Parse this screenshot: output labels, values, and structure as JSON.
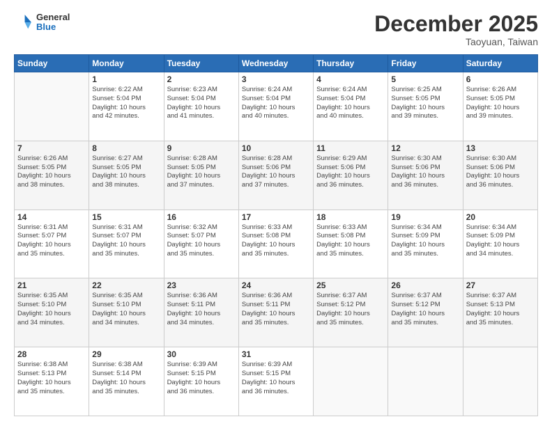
{
  "logo": {
    "general": "General",
    "blue": "Blue"
  },
  "header": {
    "month": "December 2025",
    "location": "Taoyuan, Taiwan"
  },
  "weekdays": [
    "Sunday",
    "Monday",
    "Tuesday",
    "Wednesday",
    "Thursday",
    "Friday",
    "Saturday"
  ],
  "weeks": [
    [
      {
        "day": "",
        "info": ""
      },
      {
        "day": "1",
        "info": "Sunrise: 6:22 AM\nSunset: 5:04 PM\nDaylight: 10 hours\nand 42 minutes."
      },
      {
        "day": "2",
        "info": "Sunrise: 6:23 AM\nSunset: 5:04 PM\nDaylight: 10 hours\nand 41 minutes."
      },
      {
        "day": "3",
        "info": "Sunrise: 6:24 AM\nSunset: 5:04 PM\nDaylight: 10 hours\nand 40 minutes."
      },
      {
        "day": "4",
        "info": "Sunrise: 6:24 AM\nSunset: 5:04 PM\nDaylight: 10 hours\nand 40 minutes."
      },
      {
        "day": "5",
        "info": "Sunrise: 6:25 AM\nSunset: 5:05 PM\nDaylight: 10 hours\nand 39 minutes."
      },
      {
        "day": "6",
        "info": "Sunrise: 6:26 AM\nSunset: 5:05 PM\nDaylight: 10 hours\nand 39 minutes."
      }
    ],
    [
      {
        "day": "7",
        "info": "Sunrise: 6:26 AM\nSunset: 5:05 PM\nDaylight: 10 hours\nand 38 minutes."
      },
      {
        "day": "8",
        "info": "Sunrise: 6:27 AM\nSunset: 5:05 PM\nDaylight: 10 hours\nand 38 minutes."
      },
      {
        "day": "9",
        "info": "Sunrise: 6:28 AM\nSunset: 5:05 PM\nDaylight: 10 hours\nand 37 minutes."
      },
      {
        "day": "10",
        "info": "Sunrise: 6:28 AM\nSunset: 5:06 PM\nDaylight: 10 hours\nand 37 minutes."
      },
      {
        "day": "11",
        "info": "Sunrise: 6:29 AM\nSunset: 5:06 PM\nDaylight: 10 hours\nand 36 minutes."
      },
      {
        "day": "12",
        "info": "Sunrise: 6:30 AM\nSunset: 5:06 PM\nDaylight: 10 hours\nand 36 minutes."
      },
      {
        "day": "13",
        "info": "Sunrise: 6:30 AM\nSunset: 5:06 PM\nDaylight: 10 hours\nand 36 minutes."
      }
    ],
    [
      {
        "day": "14",
        "info": "Sunrise: 6:31 AM\nSunset: 5:07 PM\nDaylight: 10 hours\nand 35 minutes."
      },
      {
        "day": "15",
        "info": "Sunrise: 6:31 AM\nSunset: 5:07 PM\nDaylight: 10 hours\nand 35 minutes."
      },
      {
        "day": "16",
        "info": "Sunrise: 6:32 AM\nSunset: 5:07 PM\nDaylight: 10 hours\nand 35 minutes."
      },
      {
        "day": "17",
        "info": "Sunrise: 6:33 AM\nSunset: 5:08 PM\nDaylight: 10 hours\nand 35 minutes."
      },
      {
        "day": "18",
        "info": "Sunrise: 6:33 AM\nSunset: 5:08 PM\nDaylight: 10 hours\nand 35 minutes."
      },
      {
        "day": "19",
        "info": "Sunrise: 6:34 AM\nSunset: 5:09 PM\nDaylight: 10 hours\nand 35 minutes."
      },
      {
        "day": "20",
        "info": "Sunrise: 6:34 AM\nSunset: 5:09 PM\nDaylight: 10 hours\nand 34 minutes."
      }
    ],
    [
      {
        "day": "21",
        "info": "Sunrise: 6:35 AM\nSunset: 5:10 PM\nDaylight: 10 hours\nand 34 minutes."
      },
      {
        "day": "22",
        "info": "Sunrise: 6:35 AM\nSunset: 5:10 PM\nDaylight: 10 hours\nand 34 minutes."
      },
      {
        "day": "23",
        "info": "Sunrise: 6:36 AM\nSunset: 5:11 PM\nDaylight: 10 hours\nand 34 minutes."
      },
      {
        "day": "24",
        "info": "Sunrise: 6:36 AM\nSunset: 5:11 PM\nDaylight: 10 hours\nand 35 minutes."
      },
      {
        "day": "25",
        "info": "Sunrise: 6:37 AM\nSunset: 5:12 PM\nDaylight: 10 hours\nand 35 minutes."
      },
      {
        "day": "26",
        "info": "Sunrise: 6:37 AM\nSunset: 5:12 PM\nDaylight: 10 hours\nand 35 minutes."
      },
      {
        "day": "27",
        "info": "Sunrise: 6:37 AM\nSunset: 5:13 PM\nDaylight: 10 hours\nand 35 minutes."
      }
    ],
    [
      {
        "day": "28",
        "info": "Sunrise: 6:38 AM\nSunset: 5:13 PM\nDaylight: 10 hours\nand 35 minutes."
      },
      {
        "day": "29",
        "info": "Sunrise: 6:38 AM\nSunset: 5:14 PM\nDaylight: 10 hours\nand 35 minutes."
      },
      {
        "day": "30",
        "info": "Sunrise: 6:39 AM\nSunset: 5:15 PM\nDaylight: 10 hours\nand 36 minutes."
      },
      {
        "day": "31",
        "info": "Sunrise: 6:39 AM\nSunset: 5:15 PM\nDaylight: 10 hours\nand 36 minutes."
      },
      {
        "day": "",
        "info": ""
      },
      {
        "day": "",
        "info": ""
      },
      {
        "day": "",
        "info": ""
      }
    ]
  ]
}
